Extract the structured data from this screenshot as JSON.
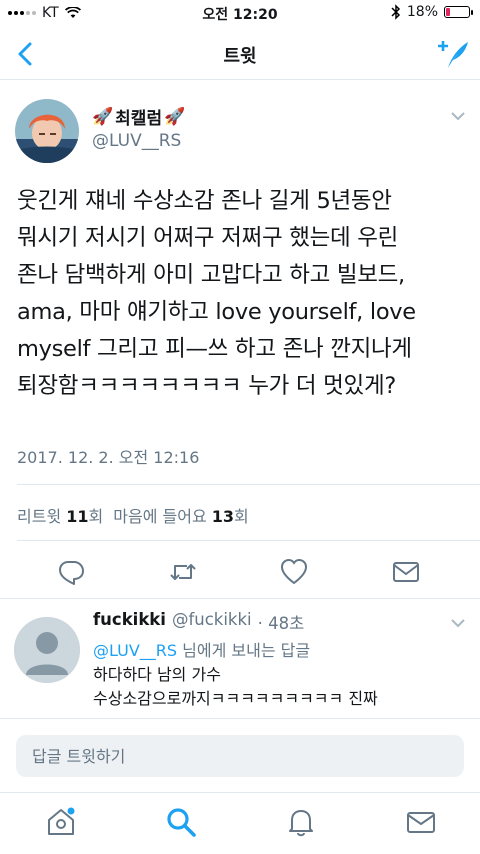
{
  "status": {
    "carrier": "KT",
    "time": "오전 12:20",
    "battery": "18%",
    "battery_level": 0.18
  },
  "nav": {
    "title": "트윗"
  },
  "tweet": {
    "display_name": "최캘럼",
    "handle": "@LUV__RS",
    "text": "웃긴게 쟤네 수상소감 존나 길게 5년동안\n뭐시기 저시기 어쩌구 저쩌구 했는데 우린\n존나 담백하게 아미 고맙다고 하고 빌보드,\nama, 마마 얘기하고 love yourself, love\nmyself 그리고 피—쓰 하고 존나 깐지나게\n퇴장함ㅋㅋㅋㅋㅋㅋㅋㅋ 누가 더 멋있게?",
    "timestamp": "2017. 12. 2. 오전 12:16",
    "retweets_label": "리트윗",
    "retweets_count": "11",
    "retweets_unit": "회",
    "likes_label": "마음에 들어요",
    "likes_count": "13",
    "likes_unit": "회"
  },
  "reply": {
    "name": "fuckikki",
    "handle": "@fuckikki",
    "time": "· 48초",
    "reply_to_mention": "@LUV__RS",
    "reply_to_suffix": " 님에게 보내는 답글",
    "text": "하다하다 남의 가수\n수상소감으로까지ㅋㅋㅋㅋㅋㅋㅋㅋㅋ 진짜"
  },
  "composer": {
    "placeholder": "답글 트윗하기"
  },
  "colors": {
    "accent": "#1da1f2",
    "muted": "#657786",
    "divider": "#e1e8ed"
  },
  "icons": [
    "chevron-left-icon",
    "compose-icon",
    "reply-icon",
    "retweet-icon",
    "heart-icon",
    "dm-icon",
    "home-icon",
    "search-icon",
    "bell-icon",
    "mail-icon"
  ]
}
